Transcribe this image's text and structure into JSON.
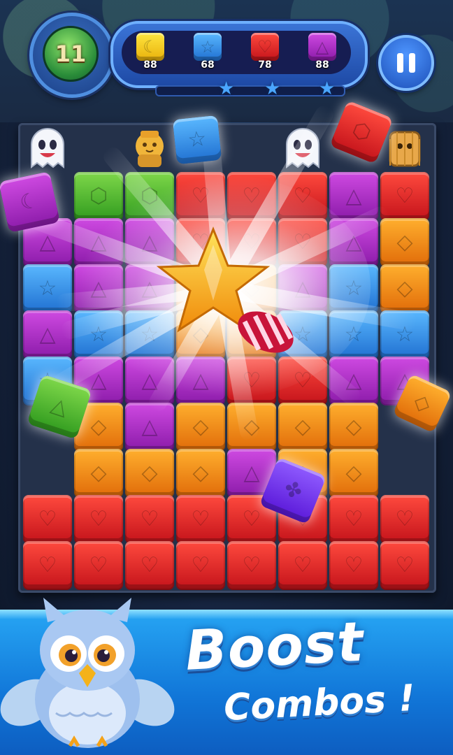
{
  "hud": {
    "moves_left": "11",
    "goals": [
      {
        "color": "yellow",
        "shape": "moon-icon",
        "count": "88"
      },
      {
        "color": "blue",
        "shape": "star-icon",
        "count": "68"
      },
      {
        "color": "red",
        "shape": "heart-icon",
        "count": "78"
      },
      {
        "color": "purple",
        "shape": "triangle-icon",
        "count": "88"
      }
    ],
    "score_progress_fraction": 0.0,
    "stars_earned": 0,
    "stars_total": 3
  },
  "board": {
    "rows": [
      [
        "ghost",
        "empty",
        "lion",
        "empty",
        "empty",
        "ghost",
        "empty",
        "dog"
      ],
      [
        "purple-fly",
        "green",
        "green",
        "red",
        "red",
        "red",
        "purple",
        "red"
      ],
      [
        "purple",
        "purple",
        "purple",
        "red",
        "red",
        "red",
        "purple",
        "orange"
      ],
      [
        "blue",
        "purple",
        "purple",
        "orange",
        "orange",
        "purple",
        "blue",
        "orange"
      ],
      [
        "purple",
        "blue",
        "blue",
        "orange",
        "orange",
        "blue",
        "blue",
        "blue"
      ],
      [
        "blue",
        "purple",
        "purple",
        "purple",
        "red",
        "red",
        "purple",
        "purple"
      ],
      [
        "empty",
        "orange",
        "purple",
        "orange",
        "orange",
        "orange",
        "orange",
        "empty"
      ],
      [
        "empty",
        "orange",
        "orange",
        "orange",
        "purple",
        "orange",
        "orange",
        "empty"
      ],
      [
        "red",
        "red",
        "red",
        "red",
        "red",
        "red",
        "red",
        "red"
      ],
      [
        "red",
        "red",
        "red",
        "red",
        "red",
        "red",
        "red",
        "red"
      ]
    ],
    "colors": {
      "red": "#e42a2a",
      "orange": "#f28c1a",
      "purple": "#b233cc",
      "blue": "#3a92ec",
      "green": "#52bb33",
      "yellow": "#f5cc22"
    }
  },
  "promo": {
    "line1": "Boost",
    "line2": "Combos !"
  }
}
